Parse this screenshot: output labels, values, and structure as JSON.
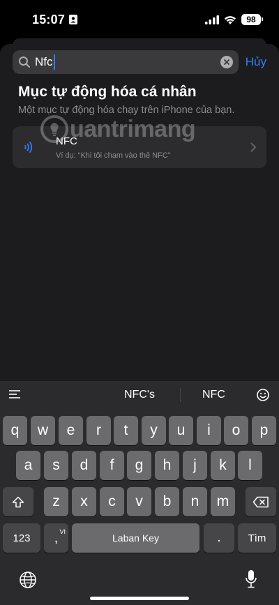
{
  "status": {
    "time": "15:07",
    "battery": "98"
  },
  "search": {
    "value": "Nfc",
    "cancel_label": "Hủy"
  },
  "section": {
    "title": "Mục tự động hóa cá nhân",
    "subtitle": "Một mục tự động hóa chạy trên iPhone của bạn."
  },
  "result": {
    "title": "NFC",
    "subtitle": "Ví dụ: “Khi tôi chạm vào thẻ NFC”"
  },
  "watermark": {
    "text": "uantrimang"
  },
  "keyboard": {
    "suggestions": [
      "NFC's",
      "NFC"
    ],
    "row1": [
      "q",
      "w",
      "e",
      "r",
      "t",
      "y",
      "u",
      "i",
      "o",
      "p"
    ],
    "row2": [
      "a",
      "s",
      "d",
      "f",
      "g",
      "h",
      "j",
      "k",
      "l"
    ],
    "row3": [
      "z",
      "x",
      "c",
      "v",
      "b",
      "n",
      "m"
    ],
    "numbers_label": "123",
    "vi_label": "VI",
    "comma_label": ",",
    "space_label": "Laban Key",
    "period_label": ".",
    "search_label": "Tìm"
  },
  "colors": {
    "accent": "#2f80ff",
    "sheet": "#1c1c1e",
    "key": "#6b6b6e"
  }
}
